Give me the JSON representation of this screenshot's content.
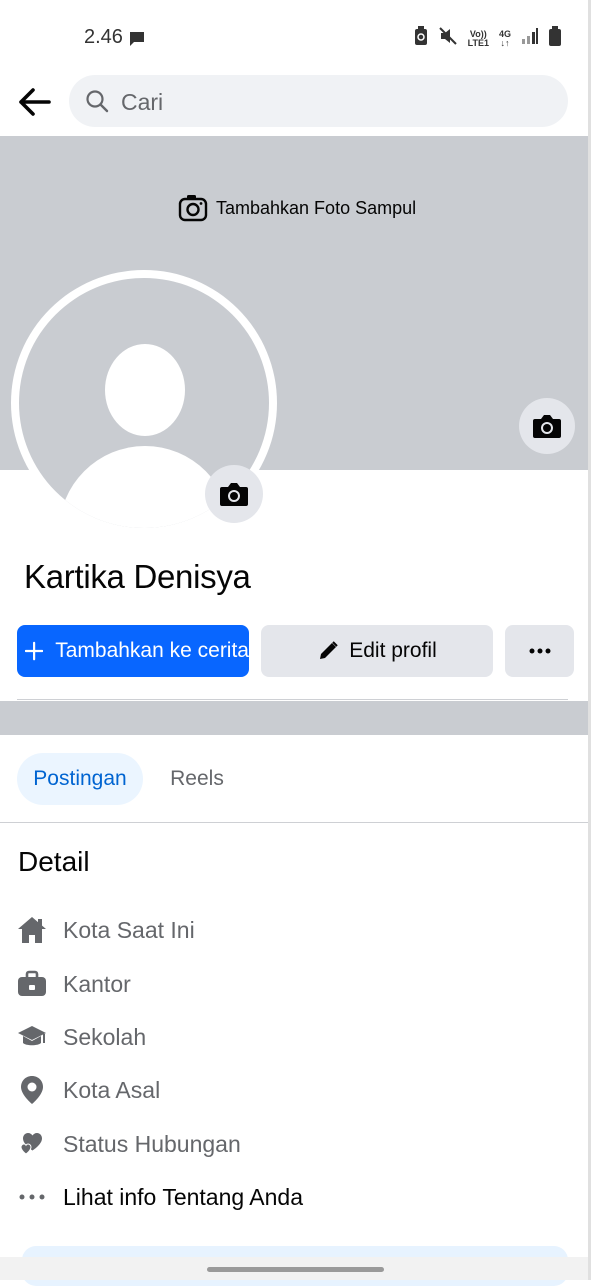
{
  "status_bar": {
    "time": "2.46",
    "volte_label": "Vo))",
    "lte_label": "LTE1",
    "network_label": "4G"
  },
  "search": {
    "placeholder": "Cari"
  },
  "cover": {
    "add_cover_label": "Tambahkan Foto Sampul"
  },
  "profile": {
    "name": "Kartika Denisya"
  },
  "actions": {
    "add_story_label": "Tambahkan ke cerita",
    "edit_profile_label": "Edit profil"
  },
  "tabs": [
    {
      "label": "Postingan",
      "active": true
    },
    {
      "label": "Reels",
      "active": false
    }
  ],
  "details": {
    "title": "Detail",
    "items": [
      {
        "label": "Kota Saat Ini",
        "icon": "home-icon"
      },
      {
        "label": "Kantor",
        "icon": "briefcase-icon"
      },
      {
        "label": "Sekolah",
        "icon": "graduation-cap-icon"
      },
      {
        "label": "Kota Asal",
        "icon": "location-pin-icon"
      },
      {
        "label": "Status Hubungan",
        "icon": "hearts-icon"
      },
      {
        "label": "Lihat info Tentang Anda",
        "icon": "more-dots-icon"
      }
    ]
  },
  "colors": {
    "primary_blue": "#0866ff",
    "tab_active_bg": "#ebf5ff",
    "tab_active_text": "#0064d1",
    "cover_gray": "#c9ccd1",
    "button_gray": "#e4e6eb"
  }
}
